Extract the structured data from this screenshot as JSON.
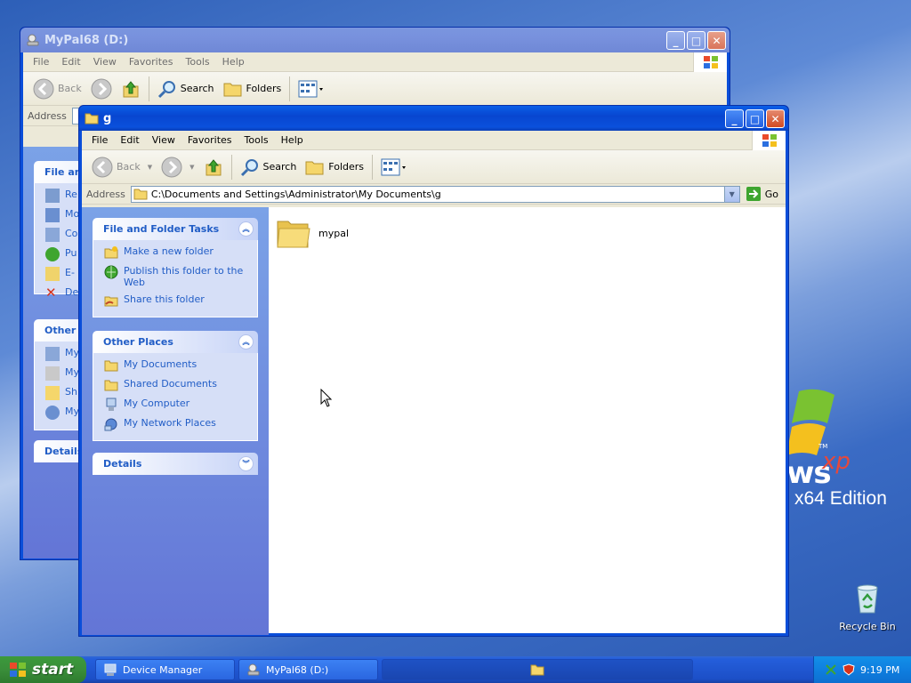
{
  "desktop": {
    "brand_suffix": "ws",
    "brand_xp": "xp",
    "brand_tm": "TM",
    "edition": "x64 Edition",
    "recycle_bin": "Recycle Bin"
  },
  "back_window": {
    "title": "MyPal68 (D:)",
    "menu": [
      "File",
      "Edit",
      "View",
      "Favorites",
      "Tools",
      "Help"
    ],
    "toolbar": {
      "back": "Back",
      "search": "Search",
      "folders": "Folders"
    },
    "address_label": "Address",
    "panels": {
      "file_tasks": "File an",
      "other": "Other",
      "details": "Details"
    },
    "file_tasks_items": [
      "Re",
      "Mo",
      "Co",
      "Pu",
      "E-",
      "De"
    ],
    "other_items": [
      "My",
      "My",
      "Sh",
      "My"
    ]
  },
  "front_window": {
    "title": "g",
    "menu": [
      "File",
      "Edit",
      "View",
      "Favorites",
      "Tools",
      "Help"
    ],
    "toolbar": {
      "back": "Back",
      "search": "Search",
      "folders": "Folders"
    },
    "address_label": "Address",
    "address_value": "C:\\Documents and Settings\\Administrator\\My Documents\\g",
    "go_label": "Go",
    "file_folder_tasks": {
      "title": "File and Folder Tasks",
      "items": [
        "Make a new folder",
        "Publish this folder to the Web",
        "Share this folder"
      ]
    },
    "other_places": {
      "title": "Other Places",
      "items": [
        "My Documents",
        "Shared Documents",
        "My Computer",
        "My Network Places"
      ]
    },
    "details": {
      "title": "Details"
    },
    "files": [
      {
        "name": "mypal",
        "type": "folder"
      }
    ]
  },
  "taskbar": {
    "start": "start",
    "buttons": [
      "Device Manager",
      "MyPal68 (D:)"
    ],
    "clock": "9:19 PM"
  },
  "colors": {
    "title_active": "#0a50dc",
    "task_link": "#215dc6",
    "taskpane_bg": "#7ba2e7",
    "start_green": "#3a8e3a"
  }
}
